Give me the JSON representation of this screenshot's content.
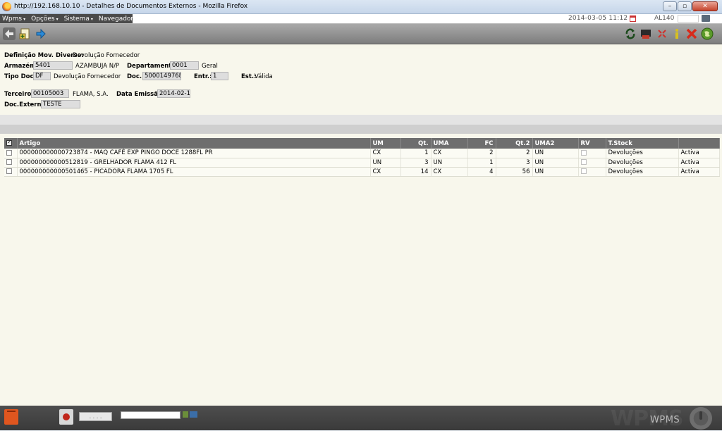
{
  "window": {
    "title": "http://192.168.10.10 - Detalhes de Documentos Externos - Mozilla Firefox",
    "buttons": {
      "minimize": "–",
      "maximize": "▫",
      "close": "✕"
    }
  },
  "menubar": {
    "items": [
      "Wpms",
      "Opções",
      "Sistema",
      "Navegador"
    ],
    "caret": "▾",
    "datetime": "2014-03-05  11:12",
    "user_code": "AL140"
  },
  "form": {
    "definicao": {
      "label": "Definição Mov. Diverso:",
      "value": "Devolução Fornecedor"
    },
    "armazem": {
      "label": "Armazém:",
      "code": "5401",
      "name": "AZAMBUJA N/P"
    },
    "departamento": {
      "label": "Departamento:",
      "code": "0001",
      "name": "Geral"
    },
    "tipo_doc": {
      "label": "Tipo Doc.:",
      "code": "DF",
      "name": "Devolução Fornecedor"
    },
    "doc": {
      "label": "Doc.:",
      "value": "5000149768"
    },
    "entr": {
      "label": "Entr.:",
      "value": "1"
    },
    "est": {
      "label": "Est.:",
      "value": "Válida"
    },
    "terceiro": {
      "label": "Terceiro:",
      "code": "00105003",
      "name": "FLAMA, S.A."
    },
    "data_emissao": {
      "label": "Data Emissão:",
      "value": "2014-02-11"
    },
    "doc_externo": {
      "label": "Doc.Externo:",
      "value": "TESTE"
    }
  },
  "table": {
    "columns": [
      "Artigo",
      "UM",
      "Qt.",
      "UMA",
      "FC",
      "Qt.2",
      "UMA2",
      "RV",
      "T.Stock",
      ""
    ],
    "rows": [
      {
        "artigo": "000000000000723874 - MAQ CAFÉ EXP PINGO DOCE 1288FL PR",
        "um": "CX",
        "qt": "1",
        "uma": "CX",
        "fc": "2",
        "qt2": "2",
        "uma2": "UN",
        "tstock": "Devoluções",
        "estado": "Activa"
      },
      {
        "artigo": "000000000000512819 - GRELHADOR FLAMA 412 FL",
        "um": "UN",
        "qt": "3",
        "uma": "UN",
        "fc": "1",
        "qt2": "3",
        "uma2": "UN",
        "tstock": "Devoluções",
        "estado": "Activa"
      },
      {
        "artigo": "000000000000501465 - PICADORA FLAMA 1705 FL",
        "um": "CX",
        "qt": "14",
        "uma": "CX",
        "fc": "4",
        "qt2": "56",
        "uma2": "UN",
        "tstock": "Devoluções",
        "estado": "Activa"
      }
    ]
  },
  "statusbar": {
    "dots_label": ". . . .",
    "logo_big": "WPMS",
    "logo_small": "WPMS"
  },
  "colors": {
    "toolbar": "#8f8f8f",
    "menu_bg": "#4a4a4a",
    "form_bg": "#f8f7ec",
    "table_header": "#6e6e6e",
    "statusbar": "#444444"
  },
  "icons": {
    "toolbar_left": [
      "back-arrow-icon",
      "document-add-icon",
      "forward-arrow-icon"
    ],
    "toolbar_right": [
      "refresh-icon",
      "print-icon",
      "expand-icon",
      "info-icon",
      "delete-icon",
      "globe-icon"
    ]
  }
}
